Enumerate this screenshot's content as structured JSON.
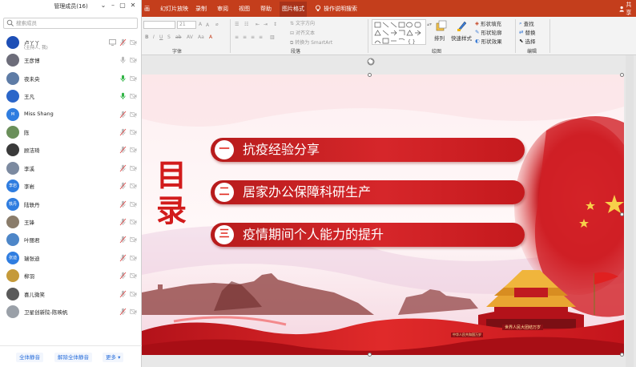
{
  "panel": {
    "title": "管理成员(16)",
    "window_controls": [
      "⌄",
      "–",
      "▢",
      "✕"
    ],
    "search_placeholder": "搜索成员",
    "members": [
      {
        "name": "卢丫丫",
        "sub": "(主持人, 我)",
        "avatar_color": "#1e4fb6",
        "avatar_text": "",
        "mic": "muted",
        "cam": "off",
        "sharing": true
      },
      {
        "name": "王彦博",
        "avatar_color": "#6d6d7a",
        "avatar_text": "",
        "mic": "gray",
        "cam": "off"
      },
      {
        "name": "夜未央",
        "avatar_color": "#5e7ca6",
        "avatar_text": "",
        "mic": "active",
        "cam": "off"
      },
      {
        "name": "王凡",
        "avatar_color": "#2b66c9",
        "avatar_text": "",
        "mic": "active",
        "cam": "off"
      },
      {
        "name": "Miss Shang",
        "avatar_color": "#2f7de0",
        "avatar_text": "M",
        "mic": "muted",
        "cam": "off"
      },
      {
        "name": "陈",
        "avatar_color": "#6a8f5a",
        "avatar_text": "",
        "mic": "muted",
        "cam": "off"
      },
      {
        "name": "顾洁琦",
        "avatar_color": "#3a3a3a",
        "avatar_text": "",
        "mic": "muted",
        "cam": "off"
      },
      {
        "name": "李溪",
        "avatar_color": "#7c8aa0",
        "avatar_text": "",
        "mic": "muted",
        "cam": "off"
      },
      {
        "name": "李岩",
        "avatar_color": "#2f7de0",
        "avatar_text": "李岩",
        "mic": "muted",
        "cam": "off"
      },
      {
        "name": "陆轶丹",
        "avatar_color": "#2f7de0",
        "avatar_text": "轶丹",
        "mic": "muted",
        "cam": "off"
      },
      {
        "name": "王锋",
        "avatar_color": "#8a7c6a",
        "avatar_text": "",
        "mic": "muted",
        "cam": "off"
      },
      {
        "name": "叶丽君",
        "avatar_color": "#4d86c8",
        "avatar_text": "",
        "mic": "muted",
        "cam": "off"
      },
      {
        "name": "瑞张迪",
        "avatar_color": "#2f7de0",
        "avatar_text": "张迪",
        "mic": "muted",
        "cam": "off"
      },
      {
        "name": "柳羽",
        "avatar_color": "#c59a3a",
        "avatar_text": "",
        "mic": "muted",
        "cam": "off"
      },
      {
        "name": "喜儿微笑",
        "avatar_color": "#5a5a5a",
        "avatar_text": "",
        "mic": "muted",
        "cam": "off"
      },
      {
        "name": "卫星创新院-陈映帆",
        "avatar_color": "#9aa0a8",
        "avatar_text": "",
        "mic": "muted",
        "cam": "off"
      }
    ],
    "buttons": {
      "mute_all": "全体静音",
      "unmute_all": "解除全体静音",
      "more": "更多 ▾"
    }
  },
  "ribbon": {
    "tabs": [
      {
        "label": "画",
        "active": false
      },
      {
        "label": "幻灯片放映",
        "active": false
      },
      {
        "label": "录制",
        "active": false
      },
      {
        "label": "审阅",
        "active": false
      },
      {
        "label": "视图",
        "active": false
      },
      {
        "label": "帮助",
        "active": false
      },
      {
        "label": "图片格式",
        "active": true
      }
    ],
    "tell_me": "操作说明搜索",
    "share": "共享",
    "font_size": "21",
    "groups": {
      "font": "字体",
      "paragraph": "段落",
      "drawing": "绘图",
      "editing": "编辑"
    },
    "paragraph_cmds": {
      "text_direction": "文字方向",
      "align_text": "对齐文本",
      "smartart": "转换为 SmartArt"
    },
    "drawing_cmds": {
      "arrange": "排列",
      "quick_styles": "快速样式",
      "shape_fill": "形状填充",
      "shape_outline": "形状轮廓",
      "shape_effects": "形状效果"
    },
    "editing_cmds": {
      "find": "查找",
      "replace": "替换",
      "select": "选择"
    }
  },
  "slide": {
    "title_vertical": [
      "目",
      "录"
    ],
    "agenda": [
      {
        "num": "一",
        "text": "抗疫经验分享"
      },
      {
        "num": "二",
        "text": "居家办公保障科研生产"
      },
      {
        "num": "三",
        "text": "疫情期间个人能力的提升"
      }
    ],
    "banner_text": "世界人民大团结万岁",
    "wall_text": "中华人民共和国万岁"
  }
}
